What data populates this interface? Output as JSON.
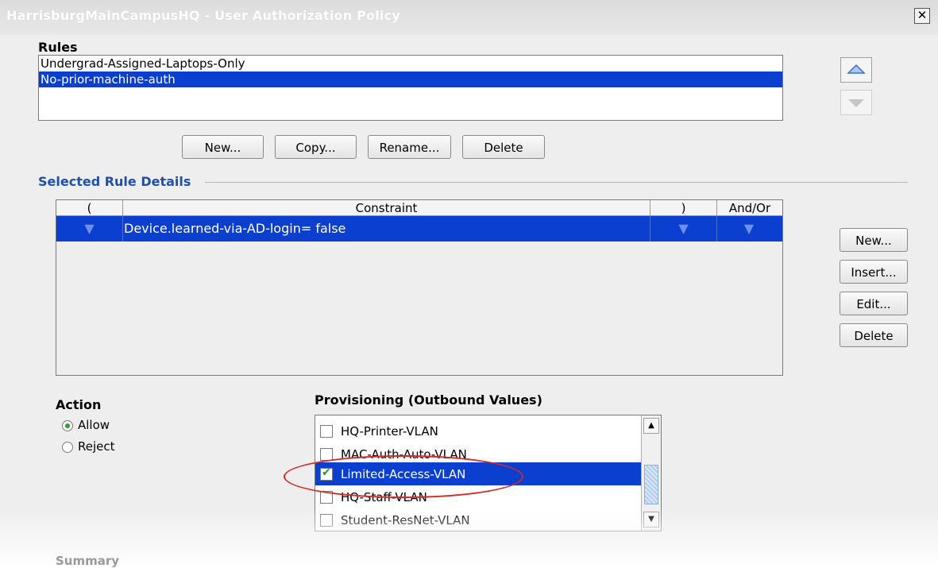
{
  "window": {
    "title": "HarrisburgMainCampusHQ - User Authorization Policy",
    "close_glyph": "✕"
  },
  "rules": {
    "label": "Rules",
    "items": [
      {
        "name": "Undergrad-Assigned-Laptops-Only",
        "selected": false
      },
      {
        "name": "No-prior-machine-auth",
        "selected": true
      }
    ],
    "buttons": {
      "new": "New...",
      "copy": "Copy...",
      "rename": "Rename...",
      "delete": "Delete"
    },
    "move_up_icon": "up-triangle-icon",
    "move_down_icon": "down-triangle-icon"
  },
  "details": {
    "label": "Selected Rule Details",
    "columns": [
      "(",
      "Constraint",
      ")",
      "And/Or"
    ],
    "rows": [
      {
        "open": "",
        "constraint": "Device.learned-via-AD-login= false",
        "close": "",
        "andor": ""
      }
    ],
    "buttons": {
      "new": "New...",
      "insert": "Insert...",
      "edit": "Edit...",
      "delete": "Delete"
    }
  },
  "action": {
    "label": "Action",
    "options": [
      {
        "label": "Allow",
        "checked": true
      },
      {
        "label": "Reject",
        "checked": false
      }
    ]
  },
  "provisioning": {
    "label": "Provisioning (Outbound Values)",
    "items": [
      {
        "label": "HQ-Printer-VLAN",
        "checked": false,
        "selected": false
      },
      {
        "label": "MAC-Auth-Auto-VLAN",
        "checked": false,
        "selected": false
      },
      {
        "label": "Limited-Access-VLAN",
        "checked": true,
        "selected": true
      },
      {
        "label": "HQ-Staff-VLAN",
        "checked": false,
        "selected": false
      },
      {
        "label": "Student-ResNet-VLAN",
        "checked": false,
        "selected": false
      }
    ],
    "highlight_color": "#d62a2a"
  },
  "summary": {
    "label": "Summary"
  },
  "colors": {
    "selection": "#0a3fcf",
    "section_heading": "#1f4fb0",
    "background": "#eeeeee"
  }
}
